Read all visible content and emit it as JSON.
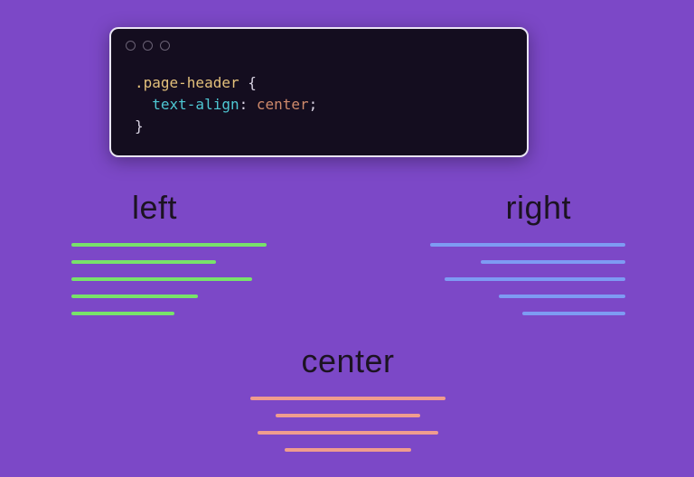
{
  "code": {
    "selector": ".page-header",
    "open_brace": " {",
    "property": "text-align",
    "colon": ": ",
    "value": "center",
    "semicolon": ";",
    "close_brace": "}"
  },
  "alignments": {
    "left": {
      "label": "left"
    },
    "right": {
      "label": "right"
    },
    "center": {
      "label": "center"
    }
  },
  "bar_widths": {
    "left": [
      216,
      160,
      200,
      140,
      114
    ],
    "right": [
      216,
      160,
      200,
      140,
      114
    ],
    "center": [
      216,
      160,
      200,
      140
    ]
  },
  "colors": {
    "background": "#7c48c7",
    "code_bg": "#140d1f",
    "code_border": "#e9e4f3",
    "left_bars": "#78e26a",
    "right_bars": "#7e9bf3",
    "center_bars": "#f09c8e",
    "selector": "#e3c07b",
    "property": "#4ec7d3",
    "value": "#cf8a6b",
    "brace": "#d8d2e2"
  }
}
